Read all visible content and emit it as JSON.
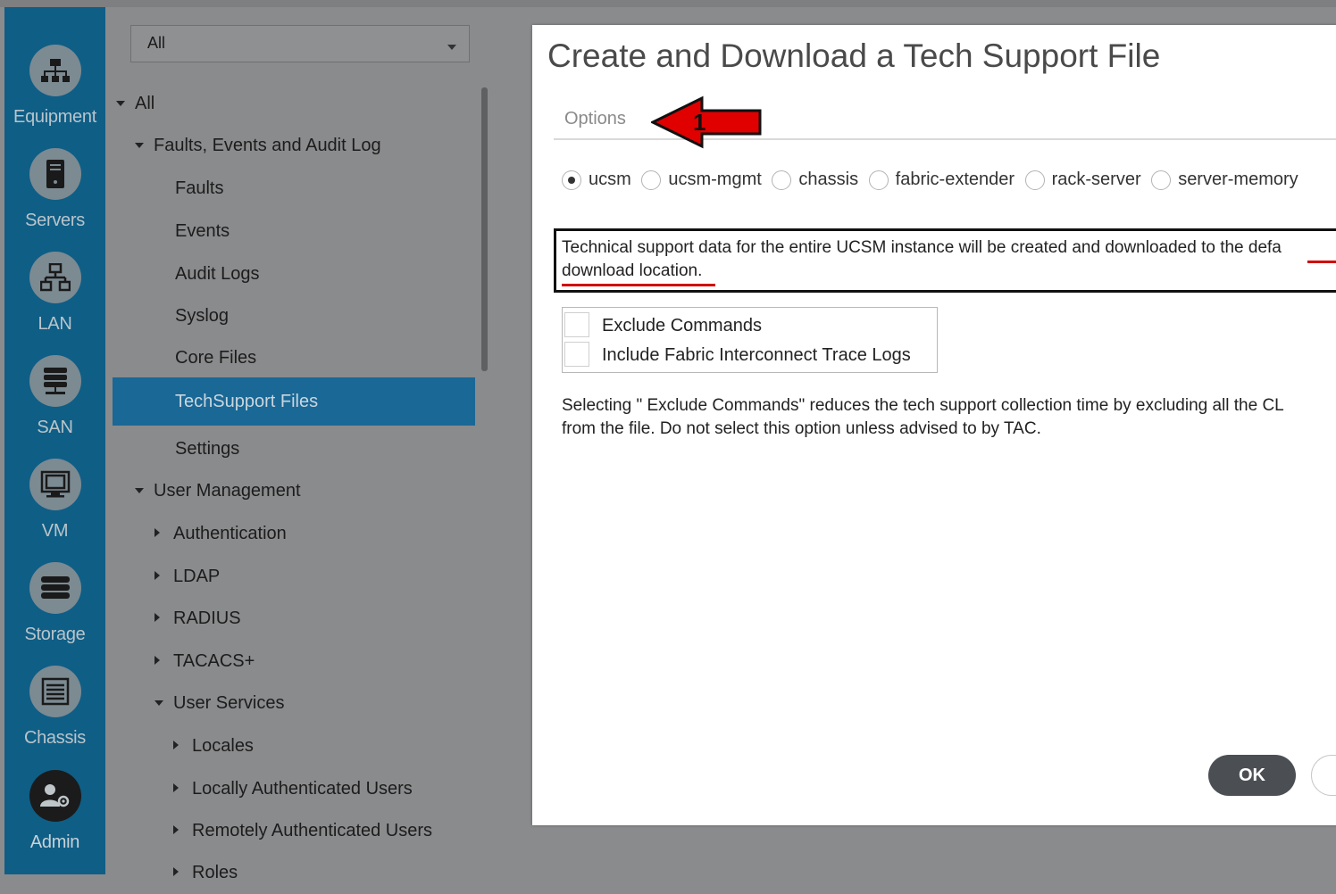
{
  "rail": {
    "items": [
      {
        "label": "Equipment",
        "icon": "equipment-icon"
      },
      {
        "label": "Servers",
        "icon": "servers-icon"
      },
      {
        "label": "LAN",
        "icon": "lan-icon"
      },
      {
        "label": "SAN",
        "icon": "san-icon"
      },
      {
        "label": "VM",
        "icon": "vm-icon"
      },
      {
        "label": "Storage",
        "icon": "storage-icon"
      },
      {
        "label": "Chassis",
        "icon": "chassis-icon"
      },
      {
        "label": "Admin",
        "icon": "admin-icon"
      }
    ]
  },
  "tree": {
    "filter_value": "All",
    "rows": [
      {
        "label": "All",
        "expander": "down"
      },
      {
        "label": "Faults, Events and Audit Log",
        "expander": "down"
      },
      {
        "label": "Faults",
        "expander": "none"
      },
      {
        "label": "Events",
        "expander": "none"
      },
      {
        "label": "Audit Logs",
        "expander": "none"
      },
      {
        "label": "Syslog",
        "expander": "none"
      },
      {
        "label": "Core Files",
        "expander": "none"
      },
      {
        "label": "TechSupport Files",
        "expander": "none",
        "selected": true
      },
      {
        "label": "Settings",
        "expander": "none"
      },
      {
        "label": "User Management",
        "expander": "down"
      },
      {
        "label": "Authentication",
        "expander": "right"
      },
      {
        "label": "LDAP",
        "expander": "right"
      },
      {
        "label": "RADIUS",
        "expander": "right"
      },
      {
        "label": "TACACS+",
        "expander": "right"
      },
      {
        "label": "User Services",
        "expander": "down"
      },
      {
        "label": "Locales",
        "expander": "right"
      },
      {
        "label": "Locally Authenticated Users",
        "expander": "right"
      },
      {
        "label": "Remotely Authenticated Users",
        "expander": "right"
      },
      {
        "label": "Roles",
        "expander": "right"
      }
    ]
  },
  "dialog": {
    "title": "Create and Download a Tech Support File",
    "tab_options": "Options",
    "annotation_number": "1",
    "radio_options": [
      {
        "label": "ucsm",
        "checked": true
      },
      {
        "label": "ucsm-mgmt",
        "checked": false
      },
      {
        "label": "chassis",
        "checked": false
      },
      {
        "label": "fabric-extender",
        "checked": false
      },
      {
        "label": "rack-server",
        "checked": false
      },
      {
        "label": "server-memory",
        "checked": false
      }
    ],
    "notice_line1": "Technical support data for the entire UCSM instance will be created and downloaded to the defa",
    "notice_line2": "download location.",
    "checkboxes": [
      {
        "label": "Exclude Commands",
        "checked": false
      },
      {
        "label": "Include Fabric Interconnect Trace Logs",
        "checked": false
      }
    ],
    "help_line1": "Selecting \" Exclude Commands\"  reduces the tech support collection time by excluding all the CL",
    "help_line2": "from the file. Do not select this option unless advised to by TAC.",
    "ok_label": "OK"
  },
  "colors": {
    "rail_bg": "#0f5e86",
    "selected_bg": "#1a6896",
    "annotation_red": "#e00000",
    "ok_bg": "#4b4f54"
  }
}
